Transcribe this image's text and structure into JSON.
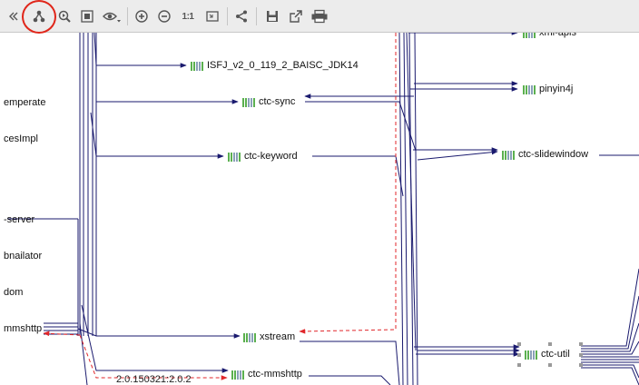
{
  "toolbar": {
    "buttons": [
      {
        "id": "expand",
        "icon": "double-chevron-left-icon",
        "label": "»"
      },
      {
        "id": "layout",
        "icon": "hierarchic-layout-icon"
      },
      {
        "id": "fit",
        "icon": "fit-content-icon"
      },
      {
        "id": "select",
        "icon": "select-frame-icon"
      },
      {
        "id": "view",
        "icon": "eye-icon"
      },
      {
        "id": "zoom-in",
        "icon": "zoom-in-icon"
      },
      {
        "id": "zoom-out",
        "icon": "zoom-out-icon"
      },
      {
        "id": "actual",
        "icon": "actual-size-icon",
        "label": "1:1"
      },
      {
        "id": "fit-page",
        "icon": "fit-page-icon"
      },
      {
        "id": "share",
        "icon": "share-icon"
      },
      {
        "id": "save",
        "icon": "save-icon"
      },
      {
        "id": "export",
        "icon": "export-icon"
      },
      {
        "id": "print",
        "icon": "print-icon"
      }
    ],
    "highlighted": "layout"
  },
  "left_labels": [
    "emperate",
    "cesImpl",
    "-server",
    "bnailator",
    "dom",
    "mmshttp"
  ],
  "nodes": {
    "isfj": "ISFJ_v2_0_119_2_BAISC_JDK14",
    "ctc_sync": "ctc-sync",
    "ctc_keyword": "ctc-keyword",
    "xstream": "xstream",
    "ctc_mmshttp": "ctc-mmshttp",
    "xml_apis": "xml-apis",
    "pinyin4j": "pinyin4j",
    "ctc_slidewindow": "ctc-slidewindow",
    "ctc_util": "ctc-util"
  },
  "edge_labels": {
    "mmshttp_version": "2.0.150321:2.0.2"
  },
  "colors": {
    "edge": "#1a1a6e",
    "conflict_edge": "#e0262a",
    "highlight_ring": "#e0261a",
    "library_bar": "#5bb04f"
  }
}
